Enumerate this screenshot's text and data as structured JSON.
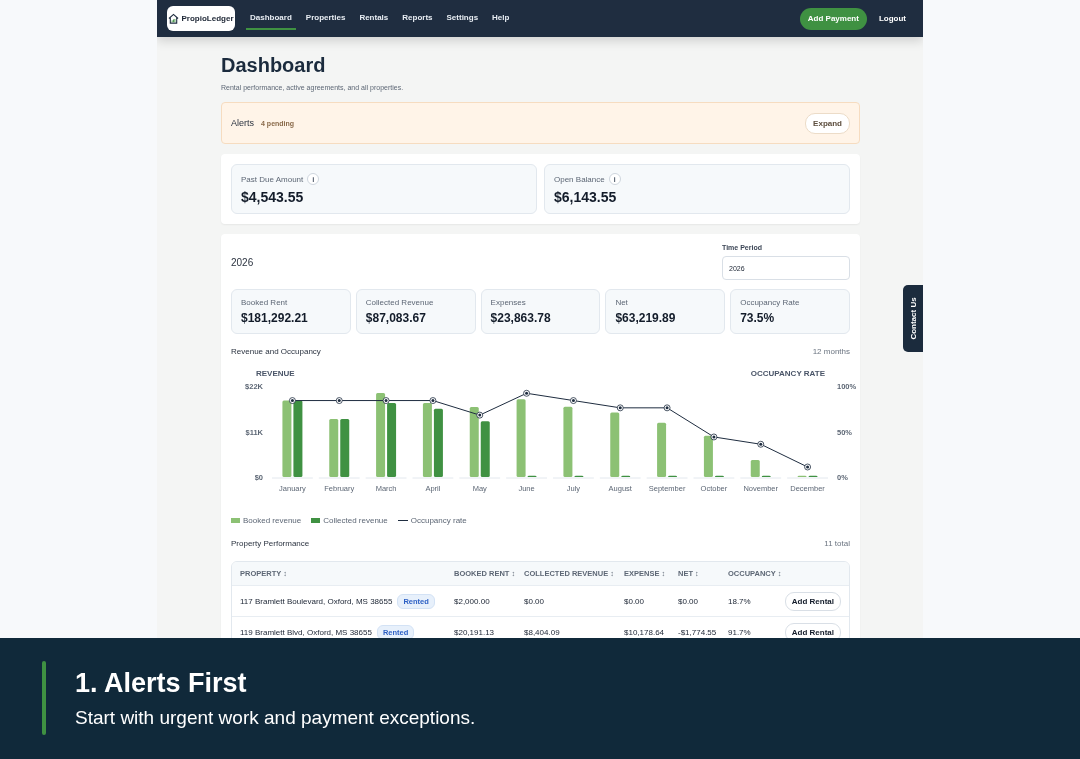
{
  "nav": {
    "logo": "PropioLedger",
    "tabs": [
      {
        "label": "Dashboard",
        "selected": true
      },
      {
        "label": "Properties",
        "selected": false
      },
      {
        "label": "Rentals",
        "selected": false
      },
      {
        "label": "Reports",
        "selected": false
      },
      {
        "label": "Settings",
        "selected": false
      },
      {
        "label": "Help",
        "selected": false
      }
    ],
    "primary_button": "Add Payment",
    "logout": "Logout"
  },
  "header": {
    "title": "Dashboard",
    "subtitle": "Rental performance, active agreements, and all properties."
  },
  "alerts": {
    "label": "Alerts",
    "count": "4 pending",
    "button": "Expand"
  },
  "balances": [
    {
      "label": "Past Due Amount",
      "info": "i",
      "value": "$4,543.55"
    },
    {
      "label": "Open Balance",
      "info": "i",
      "value": "$6,143.55"
    }
  ],
  "period": {
    "year": "2026",
    "field_label": "Time Period",
    "field_value": "2026"
  },
  "kpis": [
    {
      "label": "Booked Rent",
      "value": "$181,292.21"
    },
    {
      "label": "Collected Revenue",
      "value": "$87,083.67"
    },
    {
      "label": "Expenses",
      "value": "$23,863.78"
    },
    {
      "label": "Net",
      "value": "$63,219.89"
    },
    {
      "label": "Occupancy Rate",
      "value": "73.5%"
    }
  ],
  "revenue_chart": {
    "title": "Revenue and Occupancy",
    "range": "12 months",
    "left_axis_title": "REVENUE",
    "right_axis_title": "OCCUPANCY RATE",
    "chart_data": {
      "type": "bar",
      "categories": [
        "January",
        "February",
        "March",
        "April",
        "May",
        "June",
        "July",
        "August",
        "September",
        "October",
        "November",
        "December"
      ],
      "ylim": [
        0,
        22000
      ],
      "y2lim": [
        0,
        100
      ],
      "yticks": [
        {
          "value": 0,
          "label": "$0"
        },
        {
          "value": 11000,
          "label": "$11K"
        },
        {
          "value": 22000,
          "label": "$22K"
        }
      ],
      "y2ticks": [
        {
          "value": 0,
          "label": "0%"
        },
        {
          "value": 50,
          "label": "50%"
        },
        {
          "value": 100,
          "label": "100%"
        }
      ],
      "series": [
        {
          "name": "Booked revenue",
          "color": "#8cc174",
          "type": "bar",
          "values": [
            18500,
            14000,
            20300,
            17900,
            16900,
            18800,
            17000,
            15600,
            13100,
            10000,
            4100,
            300
          ]
        },
        {
          "name": "Collected revenue",
          "color": "#3f9142",
          "type": "bar",
          "values": [
            18500,
            14000,
            17900,
            16500,
            13500,
            300,
            300,
            300,
            300,
            300,
            300,
            300
          ]
        },
        {
          "name": "Occupancy rate",
          "color": "#1f2d40",
          "type": "line",
          "axis": "y2",
          "marker": "o",
          "values": [
            84,
            84,
            84,
            84,
            68,
            92,
            84,
            76,
            76,
            44,
            36,
            11
          ]
        }
      ]
    }
  },
  "property_table": {
    "title": "Property Performance",
    "total": "11 total",
    "sort_icon": "↕",
    "columns": [
      "PROPERTY",
      "BOOKED RENT",
      "COLLECTED REVENUE",
      "EXPENSE",
      "NET",
      "OCCUPANCY"
    ],
    "rows": [
      {
        "property": "117 Bramlett Boulevard, Oxford, MS 38655",
        "status": "Rented",
        "booked_rent": "$2,000.00",
        "collected_revenue": "$0.00",
        "expense": "$0.00",
        "net": "$0.00",
        "occupancy": "18.7%",
        "action": "Add Rental"
      },
      {
        "property": "119 Bramlett Blvd, Oxford, MS 38655",
        "status": "Rented",
        "booked_rent": "$20,191.13",
        "collected_revenue": "$8,404.09",
        "expense": "$10,178.64",
        "net": "-$1,774.55",
        "occupancy": "91.7%",
        "action": "Add Rental"
      }
    ]
  },
  "contact_tab": "Contact Us",
  "caption": {
    "title": "1. Alerts First",
    "text": "Start with urgent work and payment exceptions."
  }
}
